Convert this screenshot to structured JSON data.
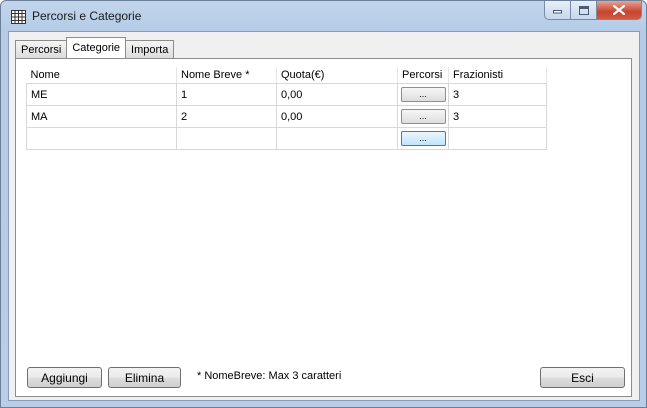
{
  "window": {
    "title": "Percorsi e Categorie"
  },
  "tabs": [
    {
      "label": "Percorsi",
      "active": false
    },
    {
      "label": "Categorie",
      "active": true
    },
    {
      "label": "Importa",
      "active": false
    }
  ],
  "grid": {
    "columns": [
      "Nome",
      "Nome Breve *",
      "Quota(€)",
      "Percorsi",
      "Frazionisti"
    ],
    "rows": [
      {
        "nome": "ME",
        "nome_breve": "1",
        "quota": "0,00",
        "percorsi": "...",
        "frazionisti": "3"
      },
      {
        "nome": "MA",
        "nome_breve": "2",
        "quota": "0,00",
        "percorsi": "...",
        "frazionisti": "3"
      },
      {
        "nome": "",
        "nome_breve": "",
        "quota": "",
        "percorsi": "...",
        "frazionisti": ""
      }
    ]
  },
  "buttons": {
    "add": "Aggiungi",
    "delete": "Elimina",
    "exit": "Esci"
  },
  "note": "* NomeBreve: Max 3 caratteri",
  "colors": {
    "accent": "#bee6fd",
    "close": "#c7432e"
  }
}
